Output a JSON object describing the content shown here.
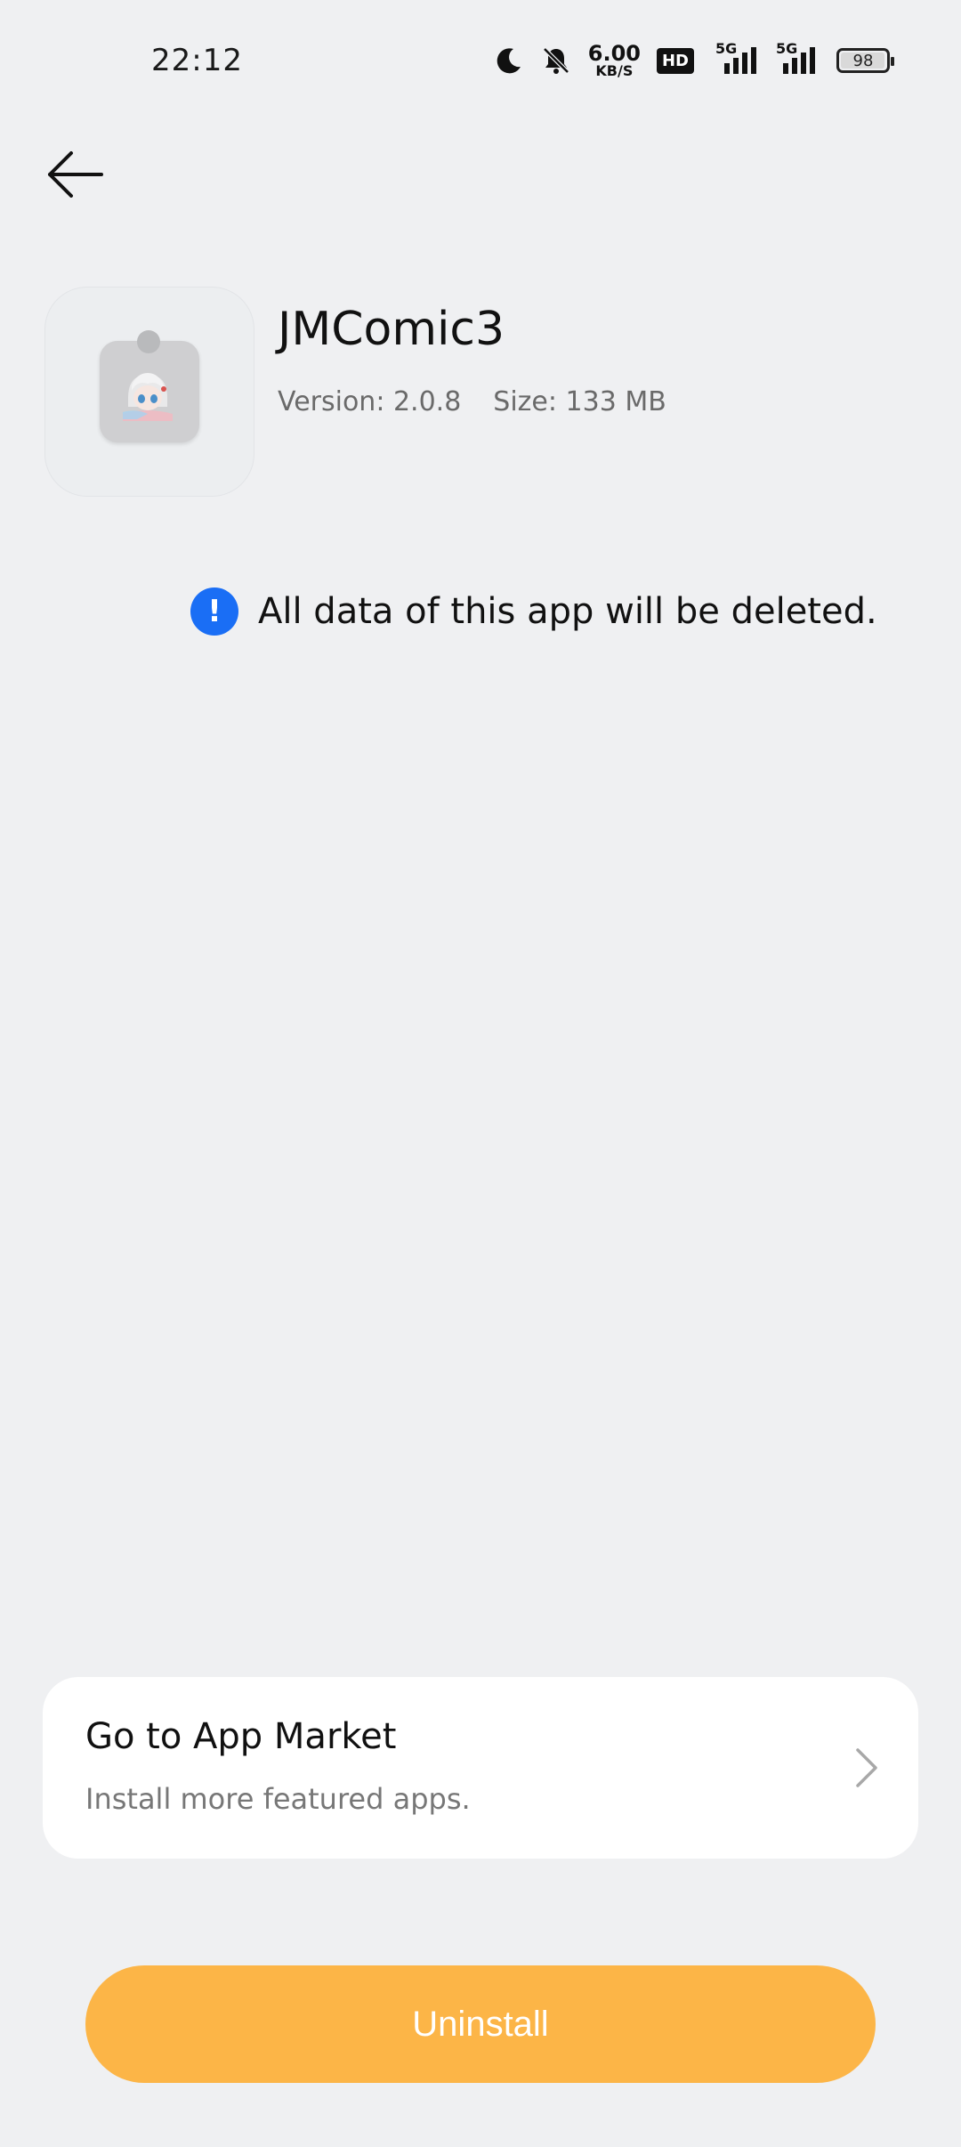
{
  "status_bar": {
    "time": "22:12",
    "net_speed_value": "6.00",
    "net_speed_unit": "KB/S",
    "hd_label": "HD",
    "signal1_label": "5G",
    "signal2_label": "5G",
    "battery_level": "98",
    "icons": [
      "moon-icon",
      "bell-off-icon",
      "signal-icon",
      "battery-icon"
    ]
  },
  "app": {
    "name": "JMComic3",
    "version_text": "Version: 2.0.8",
    "size_text": "Size: 133 MB"
  },
  "warning": {
    "text": "All data of this app will be deleted.",
    "icon": "exclamation-icon",
    "color": "#1a6ef5"
  },
  "market_card": {
    "title": "Go to App Market",
    "subtitle": "Install more featured apps."
  },
  "uninstall_button": {
    "label": "Uninstall",
    "color": "#fcb547"
  }
}
